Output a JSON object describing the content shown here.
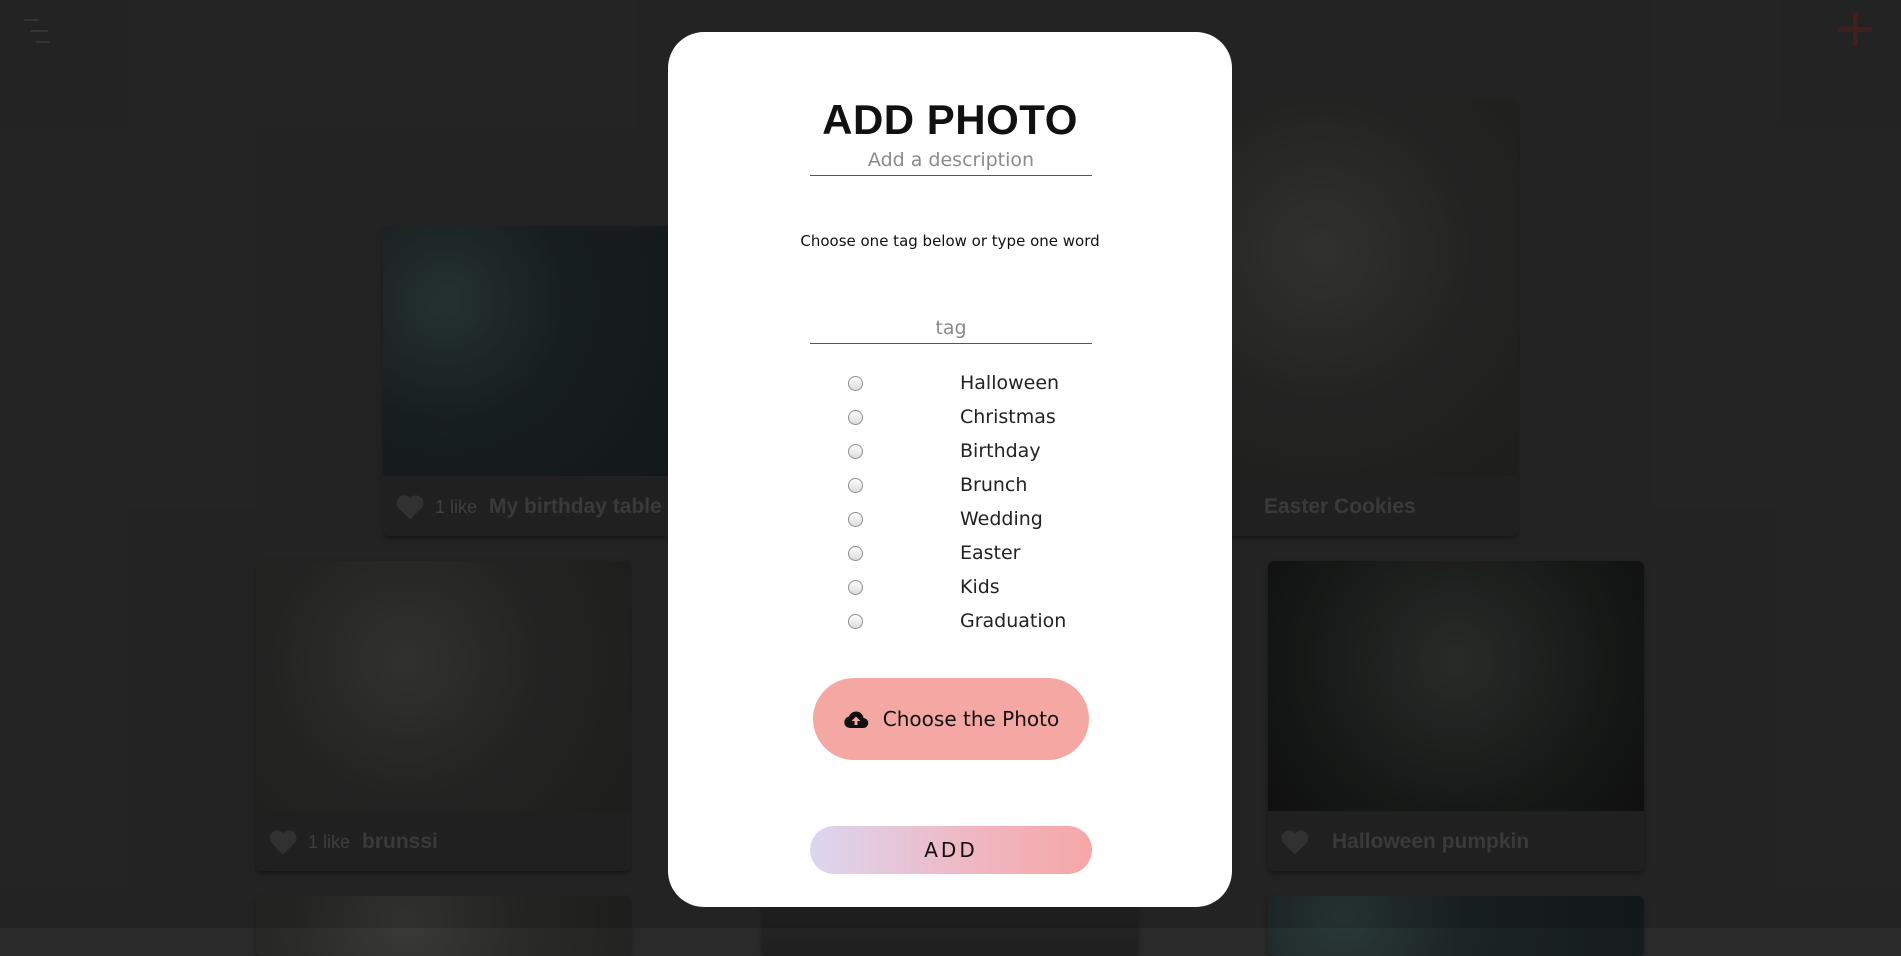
{
  "app": {
    "menu_icon": "menu-icon",
    "add_icon": "plus-icon"
  },
  "gallery": {
    "cards": [
      {
        "likes": "1 like",
        "title": "My birthday table"
      },
      {
        "likes": "",
        "title": "Easter Cookies"
      },
      {
        "likes": "1 like",
        "title": "brunssi"
      },
      {
        "likes": "",
        "title": "Halloween pumpkin"
      }
    ]
  },
  "modal": {
    "title": "ADD PHOTO",
    "description_placeholder": "Add a description",
    "hint": "Choose one tag below or type one word",
    "tag_placeholder": "tag",
    "tags": [
      "Halloween",
      "Christmas",
      "Birthday",
      "Brunch",
      "Wedding",
      "Easter",
      "Kids",
      "Graduation"
    ],
    "choose_photo_label": "Choose the Photo",
    "choose_photo_icon": "cloud-upload-icon",
    "submit_label": "ADD"
  },
  "colors": {
    "choose_button": "#f5a8a3",
    "submit_gradient_start": "#dcd6f0",
    "submit_gradient_end": "#f6a7a6",
    "backdrop": "#2a2a2a"
  }
}
